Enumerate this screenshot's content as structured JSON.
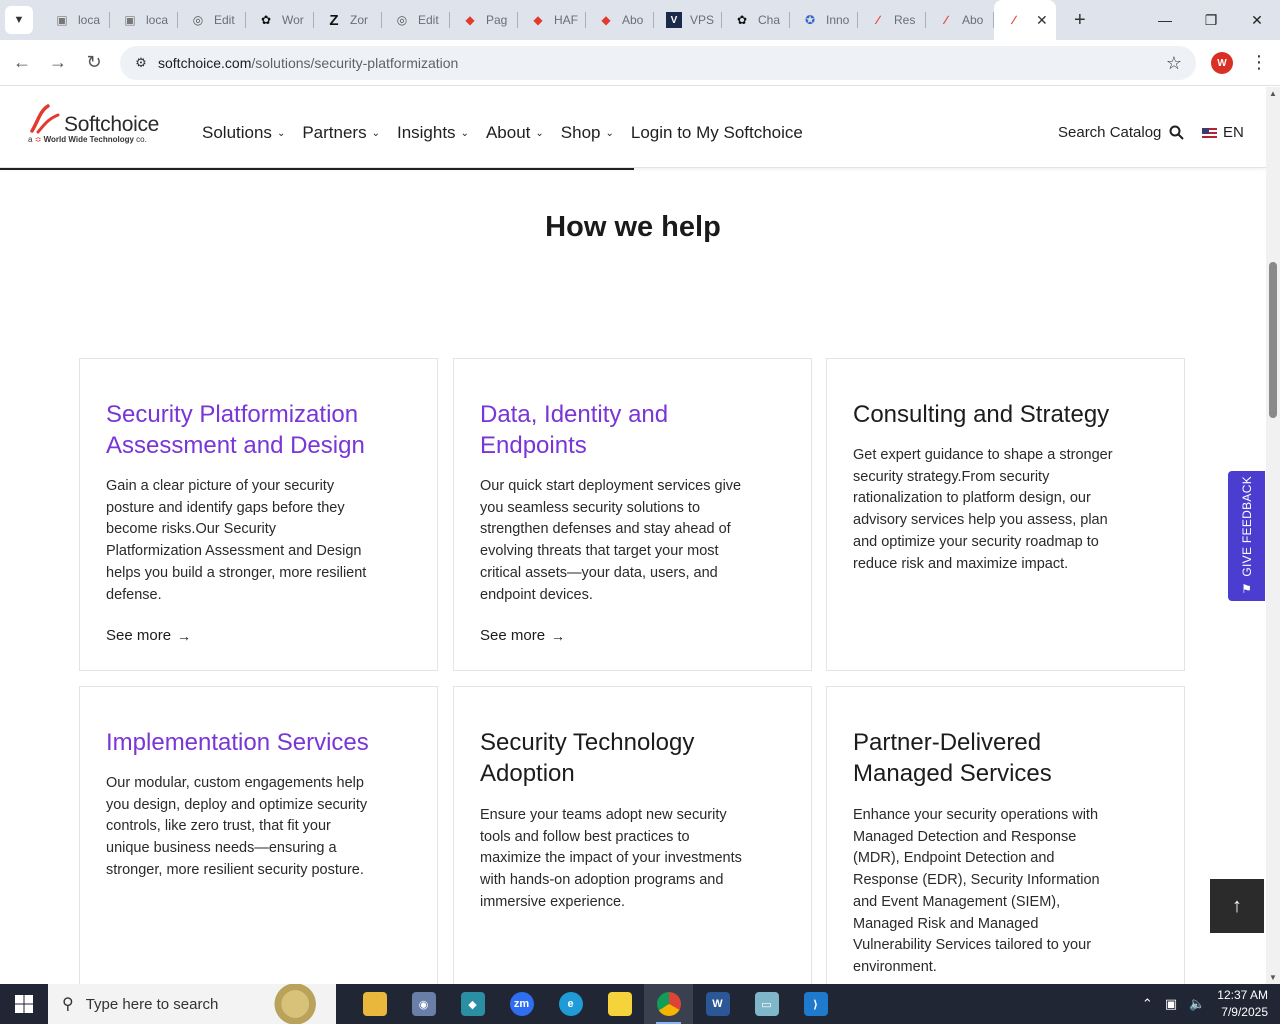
{
  "browser": {
    "tabs": [
      {
        "label": "loca",
        "icon": "page-icon"
      },
      {
        "label": "loca",
        "icon": "page-icon"
      },
      {
        "label": "Edit",
        "icon": "globe-icon"
      },
      {
        "label": "Wor",
        "icon": "openai-icon"
      },
      {
        "label": "Zor",
        "icon": "z-icon"
      },
      {
        "label": "Edit",
        "icon": "globe-icon"
      },
      {
        "label": "Pag",
        "icon": "softchoice-icon"
      },
      {
        "label": "HAF",
        "icon": "softchoice-icon"
      },
      {
        "label": "Abo",
        "icon": "softchoice-icon"
      },
      {
        "label": "VPS",
        "icon": "v-icon"
      },
      {
        "label": "Cha",
        "icon": "openai-icon"
      },
      {
        "label": "Inno",
        "icon": "tool-icon"
      },
      {
        "label": "Res",
        "icon": "softchoice-icon"
      },
      {
        "label": "Abo",
        "icon": "softchoice-icon"
      }
    ],
    "url_host": "softchoice.com",
    "url_path": "/solutions/security-platformization",
    "profile_initial": "W"
  },
  "site": {
    "logo_name": "Softchoice",
    "logo_tag_prefix": "a",
    "logo_tag_company": "World Wide Technology",
    "logo_tag_suffix": "co.",
    "nav": [
      "Solutions",
      "Partners",
      "Insights",
      "About",
      "Shop",
      "Login to My Softchoice"
    ],
    "search_label": "Search Catalog",
    "lang": "EN"
  },
  "section": {
    "heading": "How we help",
    "cards": [
      {
        "title_line1": "Security Platformization",
        "title_line2": "Assessment and Design",
        "body": "Gain a clear picture of your security posture and identify gaps before they become risks.Our Security Platformization Assessment and Design helps you build a stronger, more resilient defense.",
        "link": "See more"
      },
      {
        "title_line1": "Data, Identity and",
        "title_line2": "Endpoints",
        "body": "Our quick start deployment services give you seamless security solutions to strengthen defenses and stay ahead of evolving threats that target your most critical assets—your data, users, and endpoint devices.",
        "link": "See more"
      },
      {
        "title_line1": "Consulting and Strategy",
        "title_line2": "",
        "body": "Get expert guidance to shape a stronger security strategy.From security rationalization to platform design, our advisory services help you assess, plan and optimize your security roadmap to reduce risk and maximize impact.",
        "link": ""
      },
      {
        "title_line1": "Implementation Services",
        "title_line2": "",
        "body": "Our modular, custom engagements help you design, deploy and optimize security controls, like zero trust, that fit your unique business needs—ensuring a stronger, more resilient security posture.",
        "link": ""
      },
      {
        "title_line1": "Security Technology",
        "title_line2": "Adoption",
        "body": "Ensure your teams adopt new security tools and follow best practices to maximize the impact of your investments with hands-on adoption programs and immersive experience.",
        "link": ""
      },
      {
        "title_line1": "Partner-Delivered",
        "title_line2": "Managed Services",
        "body": "Enhance your security operations with Managed Detection and Response (MDR), Endpoint Detection and Response (EDR), Security Information and Event Management (SIEM), Managed Risk and Managed Vulnerability Services tailored to your environment.",
        "link": ""
      }
    ],
    "feedback_label": "GIVE FEEDBACK"
  },
  "taskbar": {
    "search_placeholder": "Type here to search",
    "time": "12:37 AM",
    "date": "7/9/2025"
  },
  "colors": {
    "accent_purple": "#7a35d6",
    "feedback_blue": "#4b3dcf",
    "brand_red": "#e23b2e"
  }
}
